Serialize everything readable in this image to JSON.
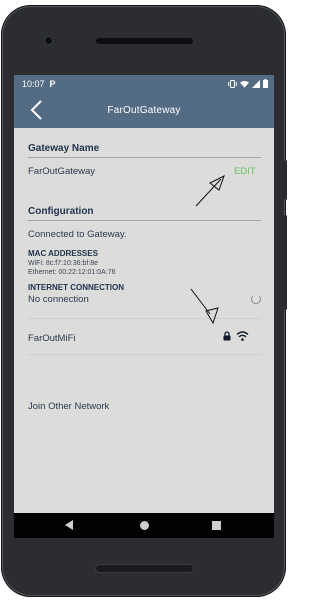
{
  "status_bar": {
    "time": "10:07",
    "app_icon": "P",
    "icons": [
      "vibrate-icon",
      "wifi-icon",
      "signal-icon",
      "battery-icon"
    ]
  },
  "app_bar": {
    "back_icon": "chevron-left-icon",
    "title": "FarOutGateway"
  },
  "gateway_name": {
    "heading": "Gateway Name",
    "value": "FarOutGateway",
    "edit_label": "EDIT"
  },
  "configuration": {
    "heading": "Configuration",
    "status": "Connected to Gateway.",
    "mac_heading": "MAC ADDRESSES",
    "wifi_mac": "WiFi: 8c:f7:10:36:bf:8e",
    "ethernet_mac": "Ethernet: 00:22:12:01:0A:76",
    "internet_heading": "INTERNET CONNECTION",
    "internet_status": "No connection"
  },
  "networks": {
    "items": [
      {
        "name": "FarOutMiFi",
        "icons": [
          "lock-icon",
          "wifi-icon"
        ]
      }
    ],
    "join_other": "Join Other Network"
  },
  "colors": {
    "app_bar": "#546b84",
    "screen_bg": "#dcdcdb",
    "heading": "#21344d",
    "edit": "#66c063",
    "frame": "#2b2d31"
  }
}
